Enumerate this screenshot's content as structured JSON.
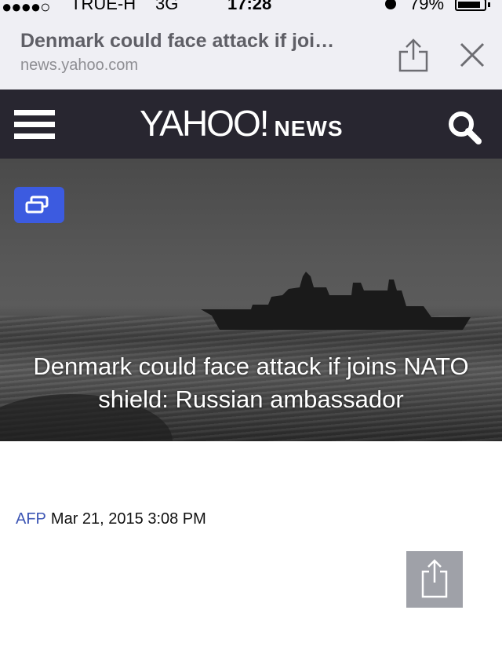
{
  "status_bar": {
    "signal": "●●●●○",
    "carrier": "TRUE-H",
    "network": "3G",
    "time": "17:28",
    "battery": "79%"
  },
  "browser": {
    "page_title": "Denmark could face attack if joi…",
    "domain": "news.yahoo.com"
  },
  "header": {
    "logo_main": "YAHOO!",
    "logo_sub": "NEWS",
    "background_color": "#282630"
  },
  "article": {
    "headline": "Denmark could face attack if joins NATO shield: Russian ambassador",
    "source": "AFP",
    "date": "Mar 21, 2015 3:08 PM",
    "accent_color": "#3c5be0"
  },
  "icons": [
    "share-icon",
    "close-icon",
    "menu-icon",
    "search-icon",
    "gallery-icon"
  ]
}
